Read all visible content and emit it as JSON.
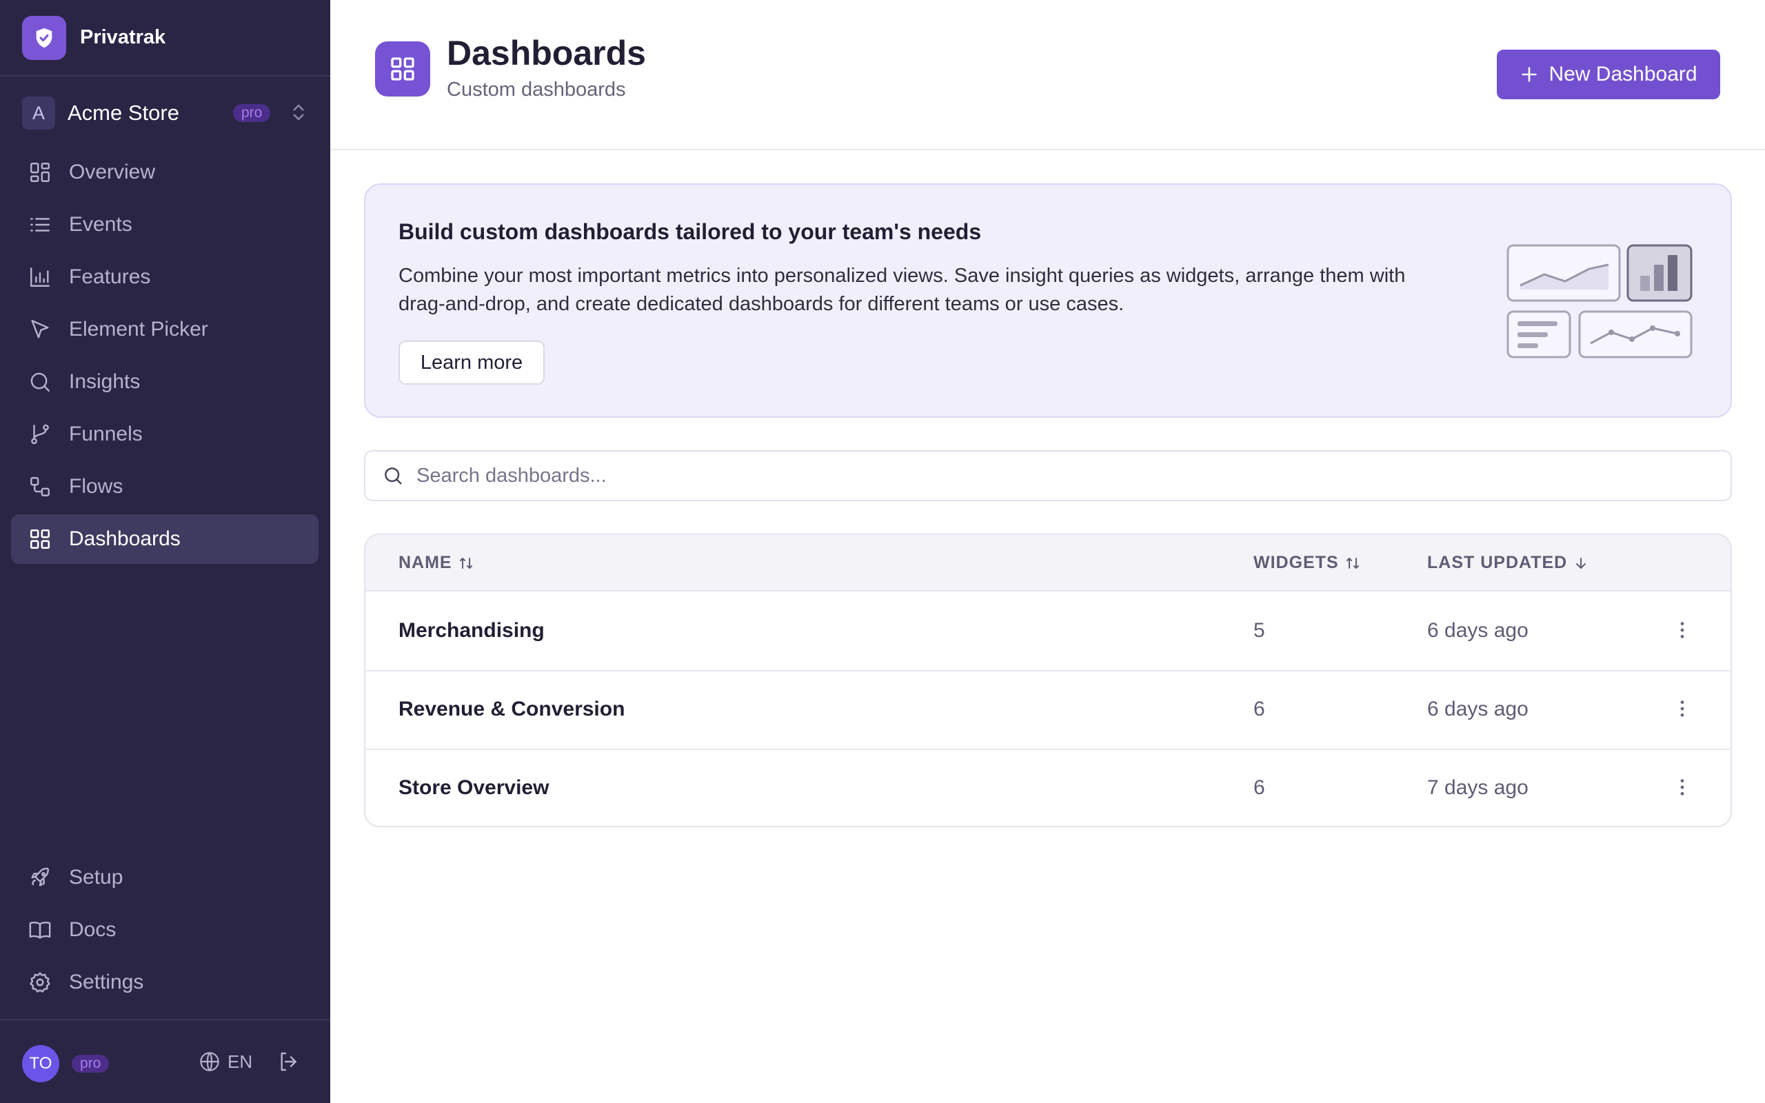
{
  "brand": {
    "name": "Privatrak"
  },
  "workspace": {
    "initial": "A",
    "name": "Acme Store",
    "plan": "pro"
  },
  "nav": {
    "items": [
      {
        "label": "Overview",
        "icon": "grid-icon"
      },
      {
        "label": "Events",
        "icon": "list-icon"
      },
      {
        "label": "Features",
        "icon": "bar-chart-icon"
      },
      {
        "label": "Element Picker",
        "icon": "cursor-icon"
      },
      {
        "label": "Insights",
        "icon": "search-icon"
      },
      {
        "label": "Funnels",
        "icon": "branch-icon"
      },
      {
        "label": "Flows",
        "icon": "flow-icon"
      },
      {
        "label": "Dashboards",
        "icon": "grid-icon",
        "active": true
      }
    ],
    "bottom": [
      {
        "label": "Setup",
        "icon": "rocket-icon"
      },
      {
        "label": "Docs",
        "icon": "book-icon"
      },
      {
        "label": "Settings",
        "icon": "gear-icon"
      }
    ]
  },
  "footer": {
    "user_initials": "TO",
    "plan": "pro",
    "language": "EN"
  },
  "header": {
    "title": "Dashboards",
    "subtitle": "Custom dashboards",
    "new_button": "New Dashboard"
  },
  "banner": {
    "title": "Build custom dashboards tailored to your team's needs",
    "text": "Combine your most important metrics into personalized views. Save insight queries as widgets, arrange them with drag-and-drop, and create dedicated dashboards for different teams or use cases.",
    "learn_more": "Learn more"
  },
  "search": {
    "placeholder": "Search dashboards..."
  },
  "table": {
    "columns": {
      "name": "NAME",
      "widgets": "WIDGETS",
      "last_updated": "LAST UPDATED"
    },
    "rows": [
      {
        "name": "Merchandising",
        "widgets": "5",
        "updated": "6 days ago"
      },
      {
        "name": "Revenue & Conversion",
        "widgets": "6",
        "updated": "6 days ago"
      },
      {
        "name": "Store Overview",
        "widgets": "6",
        "updated": "7 days ago"
      }
    ]
  },
  "colors": {
    "sidebar_bg": "#2a2545",
    "accent": "#7350d0",
    "banner_bg": "#f2effc",
    "pro_badge_bg": "#4b2e8a"
  }
}
